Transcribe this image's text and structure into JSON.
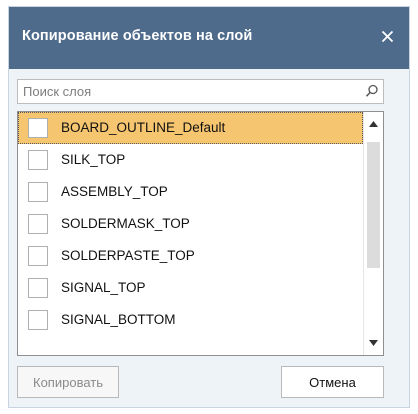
{
  "dialog": {
    "title": "Копирование объектов на слой",
    "close_icon": "close-icon"
  },
  "search": {
    "placeholder": "Поиск слоя",
    "value": "",
    "icon": "search-icon"
  },
  "layers": {
    "items": [
      {
        "label": "BOARD_OUTLINE_Default",
        "checked": false,
        "selected": true
      },
      {
        "label": "SILK_TOP",
        "checked": false,
        "selected": false
      },
      {
        "label": "ASSEMBLY_TOP",
        "checked": false,
        "selected": false
      },
      {
        "label": "SOLDERMASK_TOP",
        "checked": false,
        "selected": false
      },
      {
        "label": "SOLDERPASTE_TOP",
        "checked": false,
        "selected": false
      },
      {
        "label": "SIGNAL_TOP",
        "checked": false,
        "selected": false
      },
      {
        "label": "SIGNAL_BOTTOM",
        "checked": false,
        "selected": false
      }
    ]
  },
  "buttons": {
    "copy_label": "Копировать",
    "cancel_label": "Отмена"
  },
  "colors": {
    "titlebar": "#4f6b8c",
    "selection": "#f6c56f",
    "dialog_bg": "#eef3f8"
  }
}
